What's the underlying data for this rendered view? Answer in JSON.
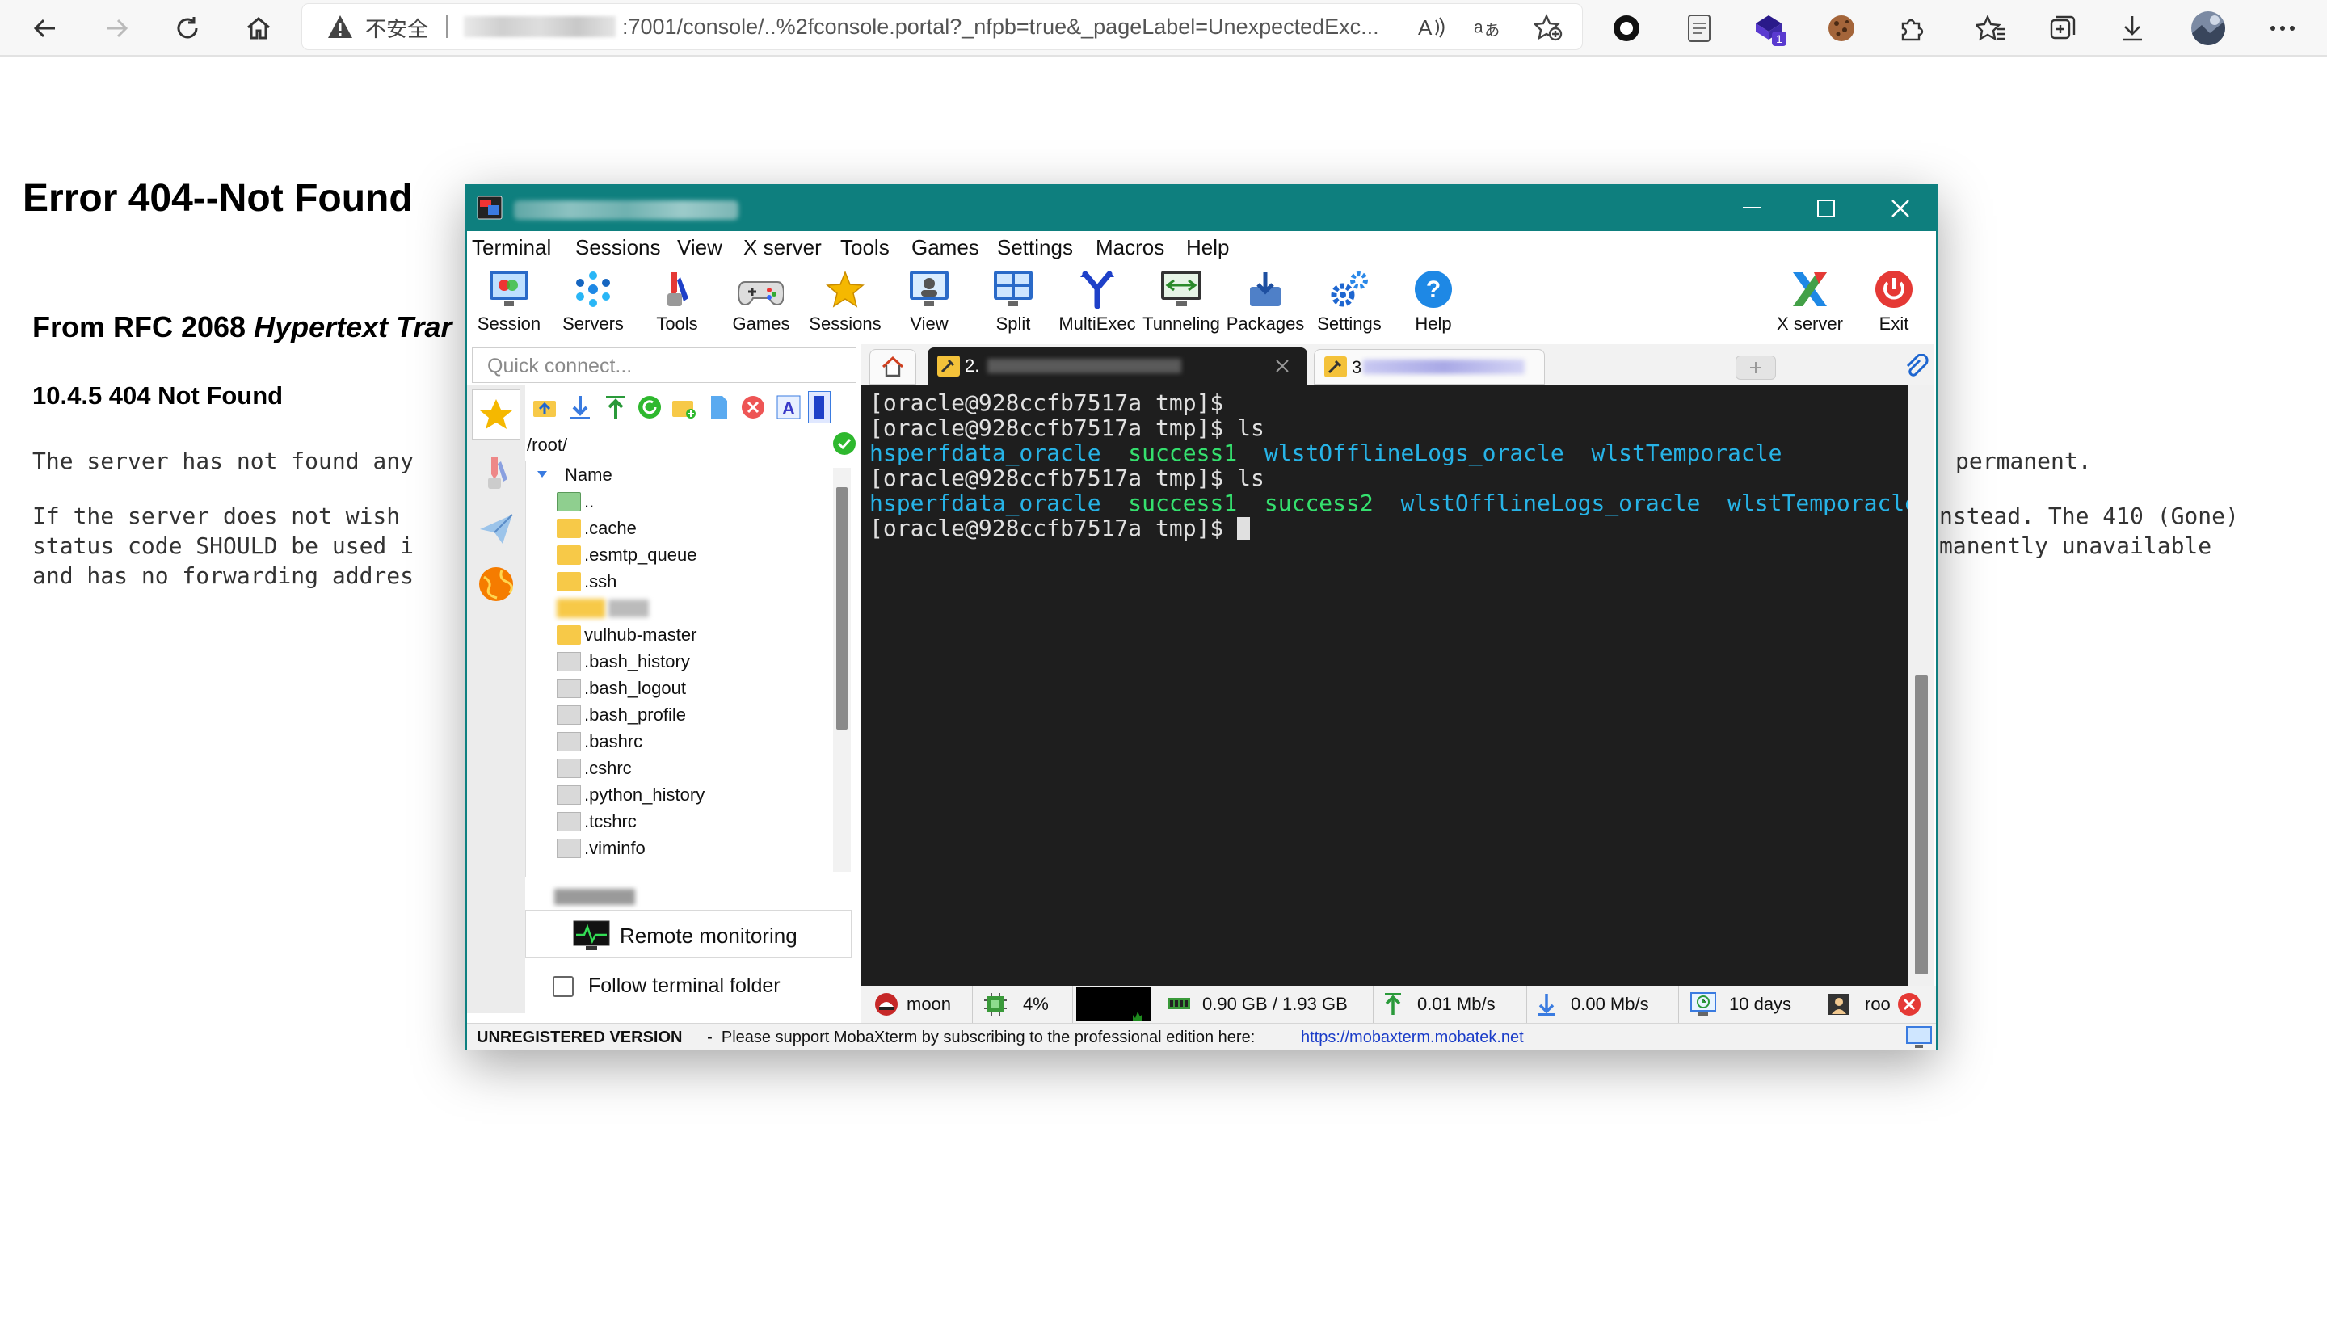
{
  "browser": {
    "security_label": "不安全",
    "url_text": ":7001/console/..%2fconsole.portal?_nfpb=true&_pageLabel=UnexpectedExc...",
    "icons": [
      "back-icon",
      "forward-icon",
      "refresh-icon",
      "home-icon",
      "warning-icon",
      "read-aloud-icon",
      "translate-icon",
      "favorite-add-icon",
      "extension-circle-icon",
      "document-icon",
      "extension-badge-icon",
      "cookie-icon",
      "extensions-icon",
      "favorites-icon",
      "collections-icon",
      "downloads-icon",
      "profile-avatar",
      "more-icon"
    ],
    "extension_badge_count": "1"
  },
  "page": {
    "heading": "Error 404--Not Found",
    "rfc_prefix": "From RFC 2068 ",
    "rfc_italic": "Hypertext Trar",
    "subheading": "10.4.5 404 Not Found",
    "para1_left": "The server has not found any",
    "para1_right": "permanent.",
    "para2_left": "If the server does not wish\nstatus code SHOULD be used i\nand has no forwarding addres",
    "para2_right": "nstead. The 410 (Gone)\nmanently unavailable"
  },
  "moba": {
    "menu": [
      "Terminal",
      "Sessions",
      "View",
      "X server",
      "Tools",
      "Games",
      "Settings",
      "Macros",
      "Help"
    ],
    "tools": [
      "Session",
      "Servers",
      "Tools",
      "Games",
      "Sessions",
      "View",
      "Split",
      "MultiExec",
      "Tunneling",
      "Packages",
      "Settings",
      "Help"
    ],
    "tools_right": [
      "X server",
      "Exit"
    ],
    "quick_connect_placeholder": "Quick connect...",
    "tab1_label": "2.",
    "tab2_label": "3",
    "sftp_path": "/root/",
    "tree_header": "Name",
    "tree_items": [
      {
        "name": "..",
        "type": "up"
      },
      {
        "name": ".cache",
        "type": "folder"
      },
      {
        "name": ".esmtp_queue",
        "type": "folder"
      },
      {
        "name": ".ssh",
        "type": "folder"
      },
      {
        "name": "",
        "type": "folder-blurred"
      },
      {
        "name": "vulhub-master",
        "type": "folder"
      },
      {
        "name": ".bash_history",
        "type": "file"
      },
      {
        "name": ".bash_logout",
        "type": "file"
      },
      {
        "name": ".bash_profile",
        "type": "file"
      },
      {
        "name": ".bashrc",
        "type": "file"
      },
      {
        "name": ".cshrc",
        "type": "file"
      },
      {
        "name": ".python_history",
        "type": "file"
      },
      {
        "name": ".tcshrc",
        "type": "file"
      },
      {
        "name": ".viminfo",
        "type": "file"
      }
    ],
    "remote_monitoring": "Remote monitoring",
    "follow_terminal_folder": "Follow terminal folder",
    "terminal": {
      "line1": "[oracle@928ccfb7517a tmp]$",
      "line2": "[oracle@928ccfb7517a tmp]$ ls",
      "line3": [
        "hsperfdata_oracle",
        "success1",
        "wlstOfflineLogs_oracle",
        "wlstTemporacle"
      ],
      "line4": "[oracle@928ccfb7517a tmp]$ ls",
      "line5": [
        "hsperfdata_oracle",
        "success1",
        "success2",
        "wlstOfflineLogs_oracle",
        "wlstTemporacle"
      ],
      "line6": "[oracle@928ccfb7517a tmp]$ "
    },
    "status": {
      "host": "moon",
      "cpu": "4%",
      "memory": "0.90 GB / 1.93 GB",
      "upload": "0.01 Mb/s",
      "download": "0.00 Mb/s",
      "uptime": "10 days",
      "user": "roo"
    },
    "unregistered": "UNREGISTERED VERSION",
    "support_text": "  -  Please support MobaXterm by subscribing to the professional edition here:  ",
    "support_link": "https://mobaxterm.mobatek.net"
  },
  "colors": {
    "moba_teal": "#0e7f7e",
    "term_bg": "#1e1e1e",
    "term_cyan": "#27b3e6",
    "term_green": "#35e06e"
  }
}
